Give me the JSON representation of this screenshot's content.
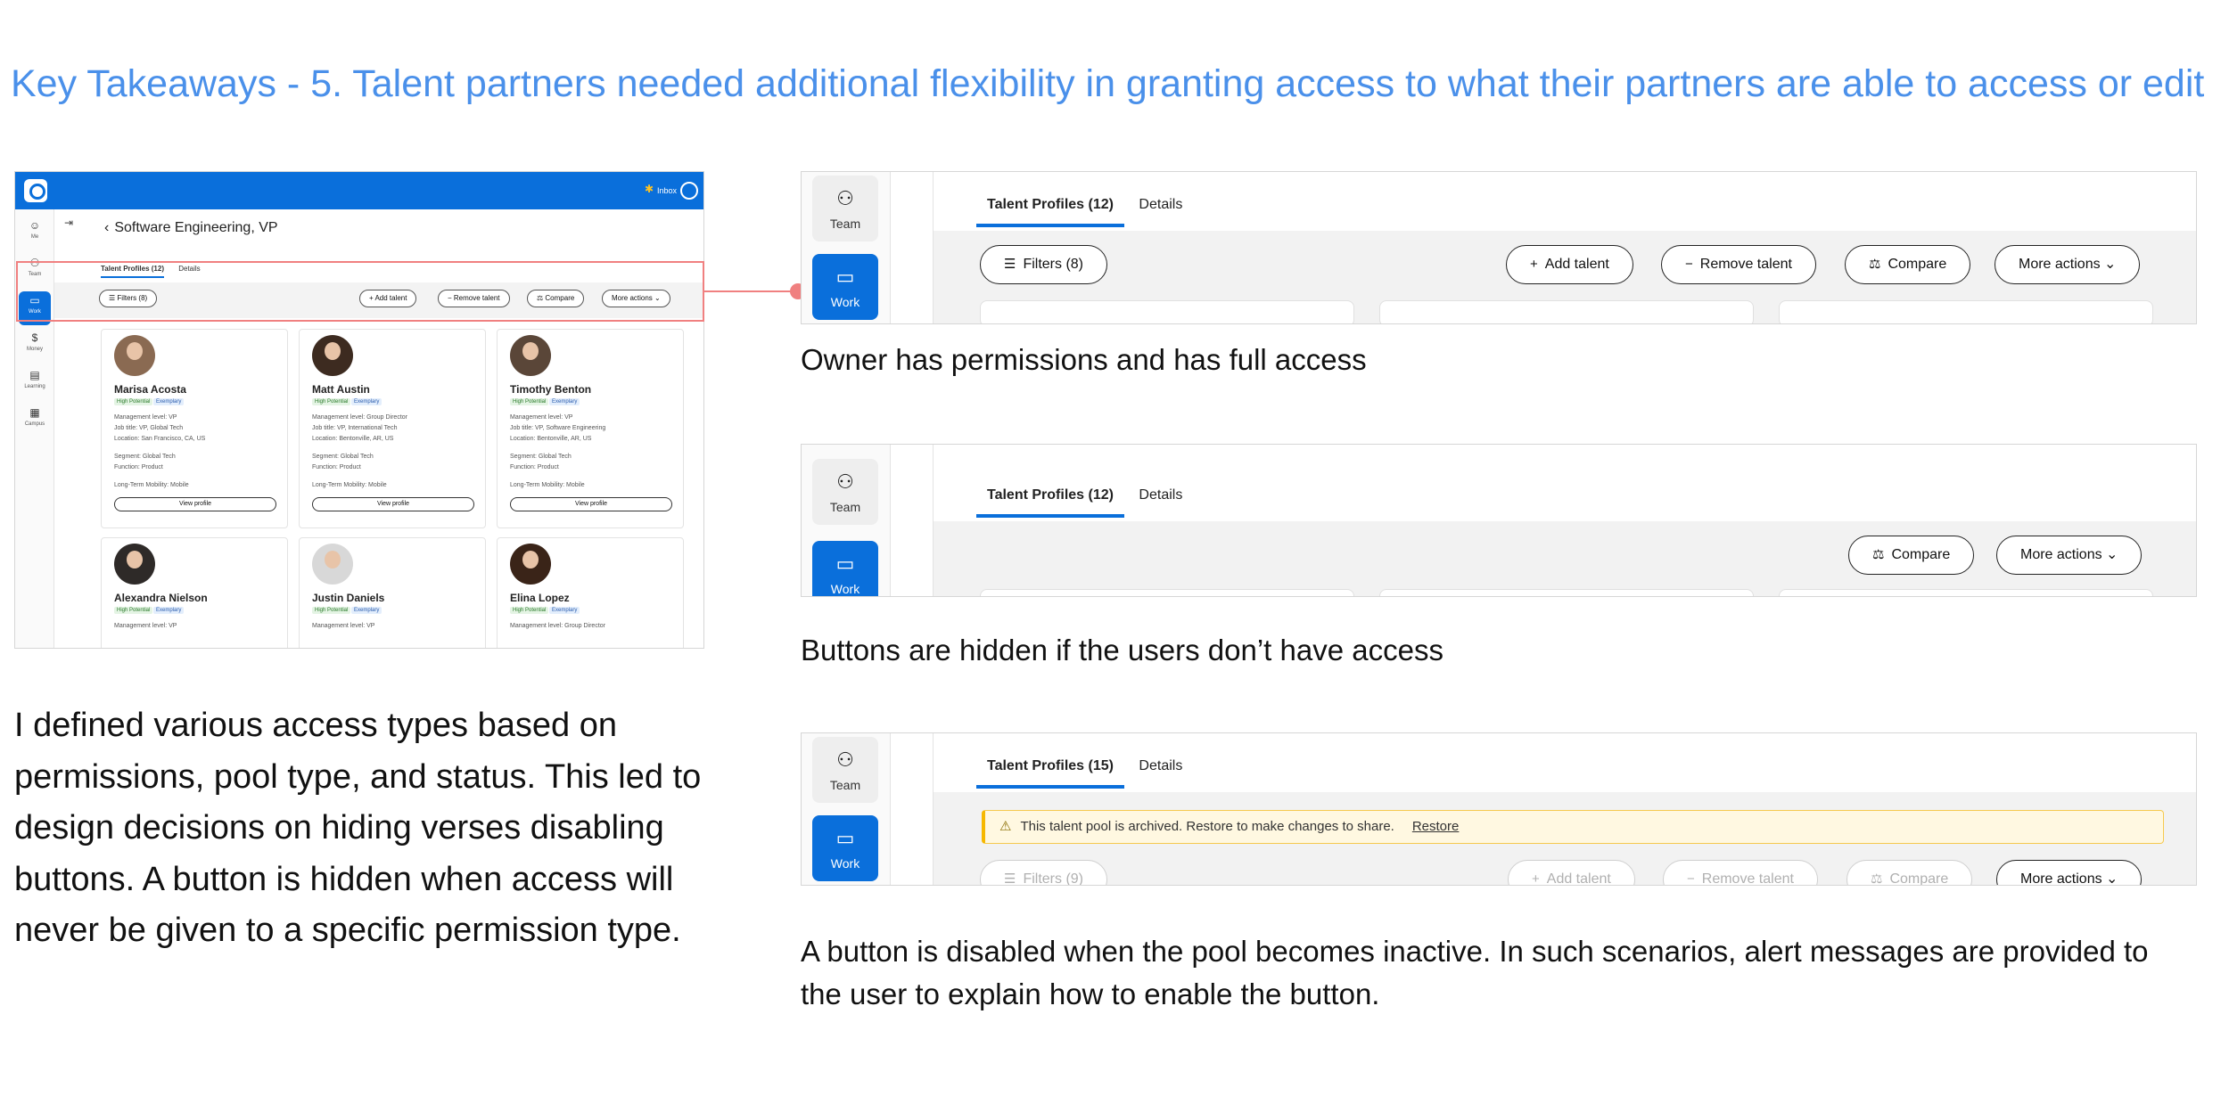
{
  "heading": "Key Takeaways - 5. Talent partners needed additional flexibility in granting access to what their partners are able to access or edit",
  "mockup": {
    "nav_items": [
      {
        "label": "Me",
        "icon": "user-circle-icon"
      },
      {
        "label": "Team",
        "icon": "team-icon"
      },
      {
        "label": "Work",
        "icon": "briefcase-icon"
      },
      {
        "label": "Money",
        "icon": "money-icon"
      },
      {
        "label": "Learning",
        "icon": "learning-icon"
      },
      {
        "label": "Campus",
        "icon": "map-icon"
      }
    ],
    "topbar_label": "Inbox",
    "page_title": "Software Engineering, VP",
    "tabs": [
      "Talent Profiles (12)",
      "Details"
    ],
    "filters_label": "Filters (8)",
    "add_label": "Add talent",
    "remove_label": "Remove talent",
    "compare_label": "Compare",
    "more_label": "More actions",
    "tag_high_potential": "High Potential",
    "tag_exemplary": "Exemplary",
    "view_profile": "View profile",
    "profiles": [
      {
        "name": "Marisa Acosta",
        "mgmt": "Management level: VP",
        "job": "Job title: VP, Global Tech",
        "location": "Location: San Francisco, CA, US",
        "segment": "Segment: Global Tech",
        "function": "Function: Product",
        "mobility": "Long-Term Mobility: Mobile"
      },
      {
        "name": "Matt Austin",
        "mgmt": "Management level: Group Director",
        "job": "Job title: VP, International Tech",
        "location": "Location: Bentonville, AR, US",
        "segment": "Segment: Global Tech",
        "function": "Function: Product",
        "mobility": "Long-Term Mobility: Mobile"
      },
      {
        "name": "Timothy Benton",
        "mgmt": "Management level: VP",
        "job": "Job title: VP, Software Engineering",
        "location": "Location: Bentonville, AR, US",
        "segment": "Segment: Global Tech",
        "function": "Function: Product",
        "mobility": "Long-Term Mobility: Mobile"
      },
      {
        "name": "Alexandra Nielson",
        "mgmt": "Management level: VP"
      },
      {
        "name": "Justin Daniels",
        "mgmt": "Management level: VP"
      },
      {
        "name": "Elina Lopez",
        "mgmt": "Management level: Group Director"
      }
    ]
  },
  "body_text": "I defined various access types based on permissions, pool type, and status. This led to design decisions on hiding verses disabling buttons. A button is hidden when access will never be given to a specific permission type.",
  "panels": [
    {
      "nav_team": "Team",
      "nav_work": "Work",
      "tab_profiles": "Talent Profiles (12)",
      "tab_details": "Details",
      "filters": "Filters (8)",
      "add": "Add talent",
      "remove": "Remove talent",
      "compare": "Compare",
      "more": "More actions",
      "caption": "Owner has permissions and has full access"
    },
    {
      "nav_team": "Team",
      "nav_work": "Work",
      "tab_profiles": "Talent Profiles (12)",
      "tab_details": "Details",
      "compare": "Compare",
      "more": "More actions",
      "caption": "Buttons are hidden if the users don’t have access"
    },
    {
      "nav_team": "Team",
      "nav_work": "Work",
      "tab_profiles": "Talent Profiles (15)",
      "tab_details": "Details",
      "alert_text": "This talent pool is archived. Restore to make changes to share.",
      "alert_link": "Restore",
      "filters": "Filters (9)",
      "add": "Add talent",
      "remove": "Remove talent",
      "compare": "Compare",
      "more": "More actions",
      "caption": "A button is disabled when the pool becomes inactive. In such scenarios, alert messages are provided to the user to explain how to enable the button."
    }
  ],
  "colors": {
    "heading": "#4a90ea",
    "primary": "#0a6fdb",
    "highlight": "#f08080",
    "alert_bg": "#fff8e1",
    "alert_border": "#f6b800"
  }
}
